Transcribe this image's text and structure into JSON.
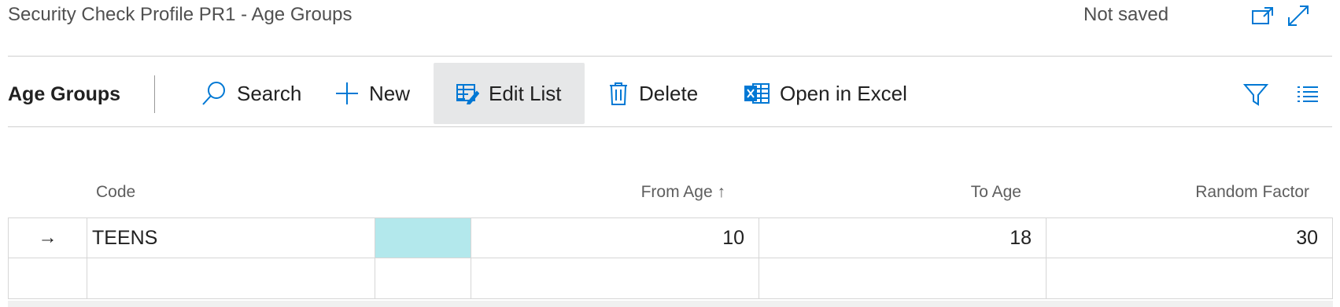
{
  "header": {
    "title": "Security Check Profile PR1 - Age Groups",
    "status": "Not saved",
    "open_new_window_icon": "open-in-new-window-icon",
    "expand_icon": "expand-icon"
  },
  "actionbar": {
    "page_name": "Age Groups",
    "search": {
      "label": "Search",
      "icon": "search-icon"
    },
    "new": {
      "label": "New",
      "icon": "plus-icon"
    },
    "edit_list": {
      "label": "Edit List",
      "icon": "edit-list-icon"
    },
    "delete": {
      "label": "Delete",
      "icon": "trash-icon"
    },
    "open_in_excel": {
      "label": "Open in Excel",
      "icon": "excel-icon"
    },
    "filter_icon": "filter-icon",
    "list_options_icon": "list-icon"
  },
  "table": {
    "columns": {
      "code": "Code",
      "from_age": "From Age",
      "from_age_sort": "↑",
      "to_age": "To Age",
      "random_factor": "Random Factor"
    },
    "rows": [
      {
        "indicator": "→",
        "code": "TEENS",
        "from_age": "10",
        "to_age": "18",
        "random_factor": "30"
      },
      {
        "indicator": "",
        "code": "",
        "from_age": "",
        "to_age": "",
        "random_factor": ""
      }
    ]
  },
  "colors": {
    "accent": "#0078d4",
    "selected_cell": "#b3e8ec",
    "active_action_bg": "#e6e7e8"
  }
}
